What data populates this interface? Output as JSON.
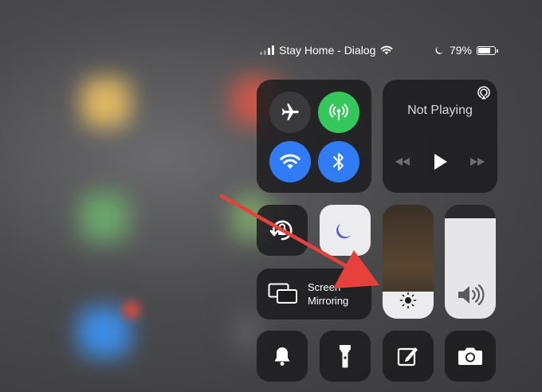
{
  "status_bar": {
    "carrier": "Stay Home - Dialog",
    "battery_percent": "79%",
    "battery_level": 0.79
  },
  "connectivity": {
    "airplane": {
      "icon": "airplane-icon",
      "active": false,
      "color": "#3a3a3c"
    },
    "cellular": {
      "icon": "cellular-antenna-icon",
      "active": true,
      "color": "#34c759"
    },
    "wifi": {
      "icon": "wifi-icon",
      "active": true,
      "color": "#2f7cf6"
    },
    "bluetooth": {
      "icon": "bluetooth-icon",
      "active": true,
      "color": "#2f7cf6"
    }
  },
  "now_playing": {
    "title": "Not Playing",
    "airplay_icon": "airplay-icon"
  },
  "screen_mirroring": {
    "line1": "Screen",
    "line2": "Mirroring"
  },
  "brightness": {
    "level": 0.24
  },
  "volume": {
    "level": 0.88
  },
  "colors": {
    "accent_blue": "#2f7cf6",
    "accent_green": "#34c759",
    "annotation_arrow": "#e8413c"
  }
}
